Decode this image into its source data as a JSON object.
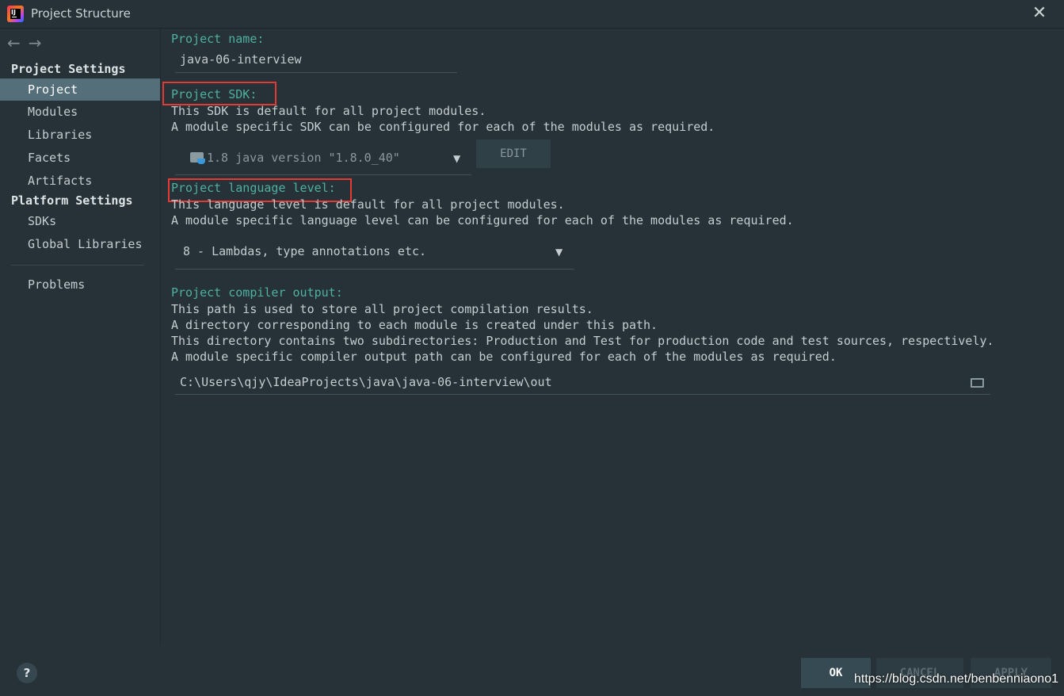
{
  "window": {
    "title": "Project Structure",
    "app_icon": "IJ"
  },
  "sidebar": {
    "back_icon": "←",
    "forward_icon": "→",
    "project_settings_header": "Project Settings",
    "project_items": [
      "Project",
      "Modules",
      "Libraries",
      "Facets",
      "Artifacts"
    ],
    "platform_settings_header": "Platform Settings",
    "platform_items": [
      "SDKs",
      "Global Libraries"
    ],
    "problems": "Problems",
    "selected": "Project"
  },
  "project_name": {
    "label": "Project name:",
    "value": "java-06-interview"
  },
  "project_sdk": {
    "label": "Project SDK:",
    "desc1": "This SDK is default for all project modules.",
    "desc2": "A module specific SDK can be configured for each of the modules as required.",
    "selected": "1.8 java version \"1.8.0_40\"",
    "edit_button": "EDIT"
  },
  "language_level": {
    "label": "Project language level:",
    "desc1": "This language level is default for all project modules.",
    "desc2": "A module specific language level can be configured for each of the modules as required.",
    "selected": "8 - Lambdas, type annotations etc."
  },
  "compiler_output": {
    "label": "Project compiler output:",
    "desc1": "This path is used to store all project compilation results.",
    "desc2": "A directory corresponding to each module is created under this path.",
    "desc3": "This directory contains two subdirectories: Production and Test for production code and test sources, respectively.",
    "desc4": "A module specific compiler output path can be configured for each of the modules as required.",
    "path": "C:\\Users\\qjy\\IdeaProjects\\java\\java-06-interview\\out"
  },
  "footer": {
    "help": "?",
    "ok": "OK",
    "cancel": "CANCEL",
    "apply": "APPLY"
  },
  "watermark": "https://blog.csdn.net/benbenniaono1",
  "colors": {
    "accent_label": "#4fb0a0",
    "highlight_box": "#e53935",
    "selection": "#546e7a"
  }
}
